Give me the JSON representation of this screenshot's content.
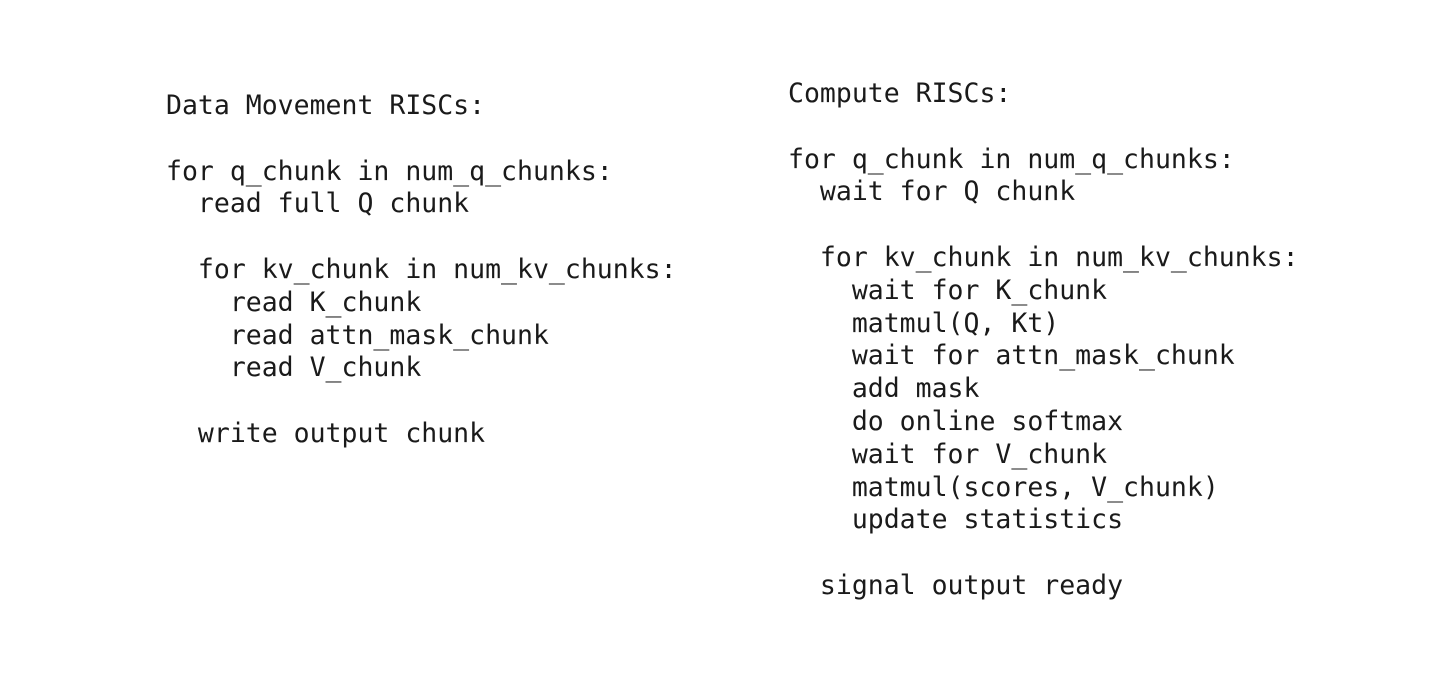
{
  "left": {
    "lines": [
      "Data Movement RISCs:",
      "",
      "for q_chunk in num_q_chunks:",
      "  read full Q chunk",
      "",
      "  for kv_chunk in num_kv_chunks:",
      "    read K_chunk",
      "    read attn_mask_chunk",
      "    read V_chunk",
      "",
      "  write output chunk"
    ]
  },
  "right": {
    "lines": [
      "Compute RISCs:",
      "",
      "for q_chunk in num_q_chunks:",
      "  wait for Q chunk",
      "",
      "  for kv_chunk in num_kv_chunks:",
      "    wait for K_chunk",
      "    matmul(Q, Kt)",
      "    wait for attn_mask_chunk",
      "    add mask",
      "    do online softmax",
      "    wait for V_chunk",
      "    matmul(scores, V_chunk)",
      "    update statistics",
      "",
      "  signal output ready"
    ]
  }
}
